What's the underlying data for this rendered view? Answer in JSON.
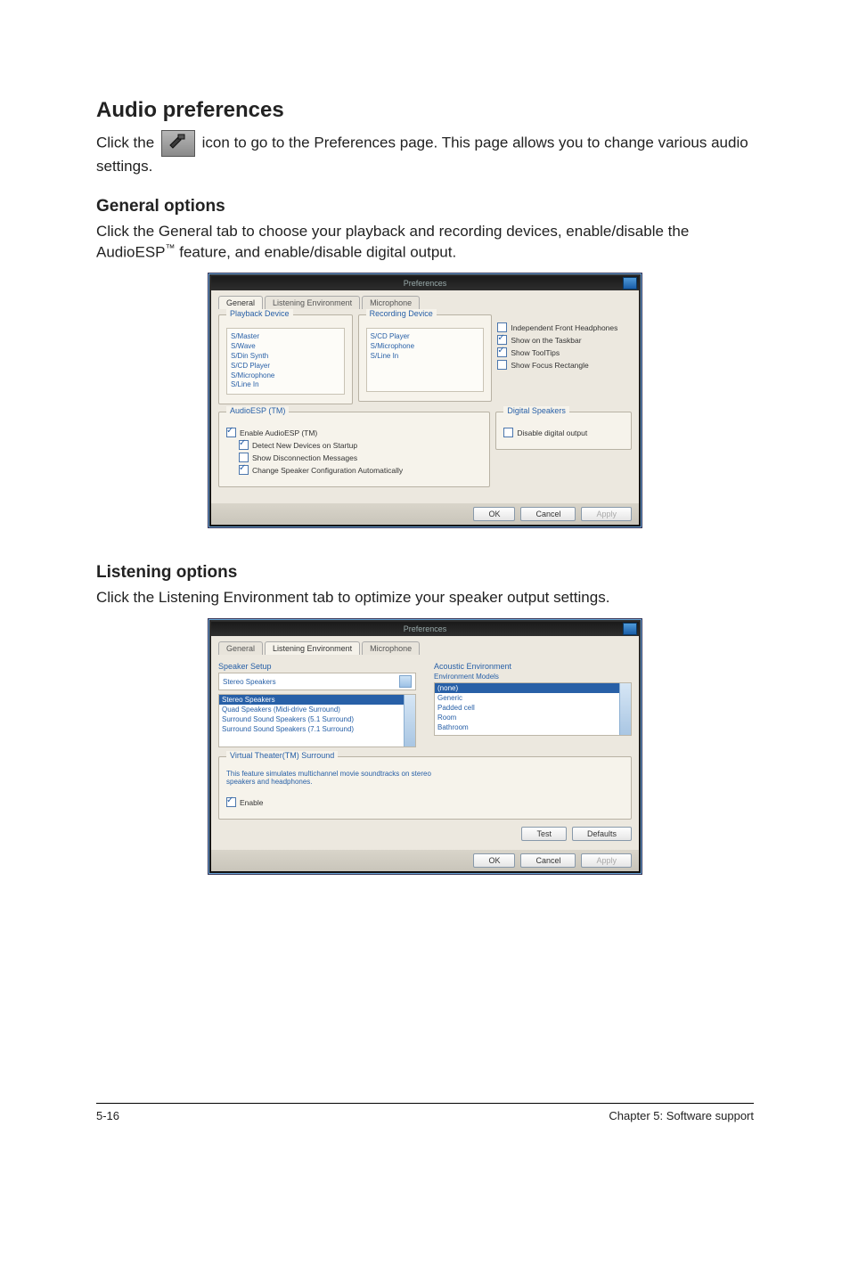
{
  "headings": {
    "audio_prefs": "Audio preferences",
    "general_opts": "General options",
    "listening_opts": "Listening options"
  },
  "paragraphs": {
    "click_icon_pre": "Click the ",
    "click_icon_post": " icon to go to the Preferences page. This page allows you to change various audio settings.",
    "general_desc_1": "Click the General tab to choose your playback and recording devices, enable/disable the AudioESP",
    "general_tm": "™",
    "general_desc_2": " feature, and enable/disable digital output.",
    "listening_desc": "Click the Listening Environment tab to optimize your speaker output settings."
  },
  "dlg1": {
    "title": "Preferences",
    "tabs": [
      "General",
      "Listening Environment",
      "Microphone"
    ],
    "grp_playback": "Playback Device",
    "grp_recording": "Recording Device",
    "grp_audioesp": "AudioESP (TM)",
    "grp_digital": "Digital Speakers",
    "playback_items": [
      "S/Master",
      "S/Wave",
      "S/Din Synth",
      "S/CD Player",
      "S/Microphone",
      "S/Line In"
    ],
    "recording_items": [
      "S/CD Player",
      "S/Microphone",
      "S/Line In"
    ],
    "right_checks": [
      {
        "label": "Independent Front Headphones",
        "checked": false
      },
      {
        "label": "Show on the Taskbar",
        "checked": true
      },
      {
        "label": "Show ToolTips",
        "checked": true
      },
      {
        "label": "Show Focus Rectangle",
        "checked": false
      }
    ],
    "esp_checks": [
      {
        "label": "Enable AudioESP (TM)",
        "checked": true
      },
      {
        "label": "Detect New Devices on Startup",
        "checked": true
      },
      {
        "label": "Show Disconnection Messages",
        "checked": false
      },
      {
        "label": "Change Speaker Configuration Automatically",
        "checked": true
      }
    ],
    "digital_check": {
      "label": "Disable digital output",
      "checked": false
    },
    "buttons": {
      "ok": "OK",
      "cancel": "Cancel",
      "apply": "Apply"
    }
  },
  "dlg2": {
    "title": "Preferences",
    "tabs": [
      "General",
      "Listening Environment",
      "Microphone"
    ],
    "grp_speaker_setup": "Speaker Setup",
    "grp_acoustic": "Acoustic Environment",
    "speaker_setup_label": "Speaker Setup",
    "speaker_setup_value": "Stereo Speakers",
    "env_models_label": "Environment Models",
    "speaker_options": [
      "Stereo Speakers",
      "Quad Speakers (Midi-drive Surround)",
      "Surround Sound Speakers (5.1 Surround)",
      "Surround Sound Speakers (7.1 Surround)"
    ],
    "env_options": [
      "(none)",
      "Generic",
      "Padded cell",
      "Room",
      "Bathroom"
    ],
    "vt_group": "Virtual Theater(TM) Surround",
    "vt_desc": "This feature simulates multichannel movie soundtracks on stereo speakers and headphones.",
    "vt_enable": "Enable",
    "buttons": {
      "test": "Test",
      "default": "Defaults",
      "ok": "OK",
      "cancel": "Cancel",
      "apply": "Apply"
    }
  },
  "footer": {
    "left": "5-16",
    "right": "Chapter 5: Software support"
  }
}
